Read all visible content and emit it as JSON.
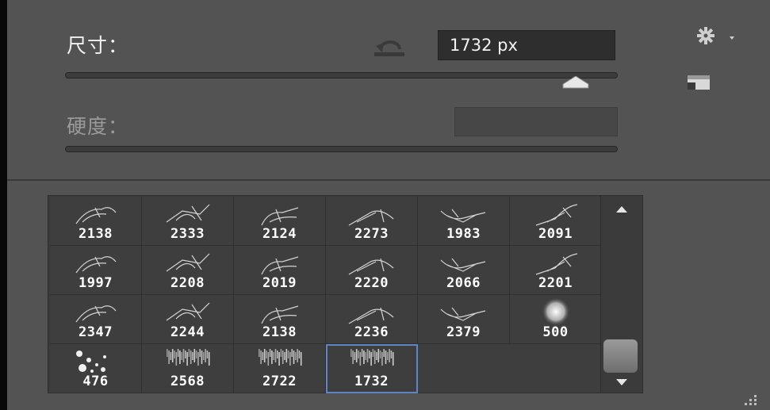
{
  "size_label": "尺寸：",
  "size_value": "1732 px",
  "hardness_label": "硬度：",
  "icons": {
    "reset": "reset-icon",
    "settings": "gear-icon",
    "panel_toggle": "panel-icon",
    "scroll_up": "scroll-up-icon",
    "scroll_down": "scroll-down-icon",
    "resize": "resize-grip-icon"
  },
  "colors": {
    "selected_outline": "#5d86c4",
    "panel_bg": "#535353"
  },
  "brushes": [
    {
      "size": "2138"
    },
    {
      "size": "2333"
    },
    {
      "size": "2124"
    },
    {
      "size": "2273"
    },
    {
      "size": "1983"
    },
    {
      "size": "2091"
    },
    {
      "size": "1997"
    },
    {
      "size": "2208"
    },
    {
      "size": "2019"
    },
    {
      "size": "2220"
    },
    {
      "size": "2066"
    },
    {
      "size": "2201"
    },
    {
      "size": "2347"
    },
    {
      "size": "2244"
    },
    {
      "size": "2138"
    },
    {
      "size": "2236"
    },
    {
      "size": "2379"
    },
    {
      "size": "500"
    },
    {
      "size": "476"
    },
    {
      "size": "2568"
    },
    {
      "size": "2722"
    },
    {
      "size": "1732",
      "selected": true
    }
  ]
}
